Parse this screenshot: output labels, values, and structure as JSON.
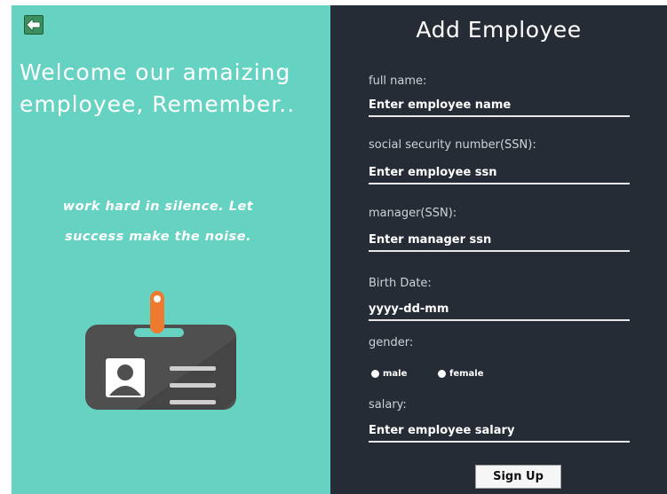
{
  "left_panel": {
    "welcome_line1": "Welcome our amaizing",
    "welcome_line2": "employee, Remember..",
    "quote_line1": "work hard in silence. Let",
    "quote_line2": "success make the noise.",
    "back_icon": "back-arrow-icon",
    "badge_icon": "employee-id-badge-icon",
    "colors": {
      "background": "#66d3c2",
      "badge": "#4f4f4f",
      "clip": "#ee7a2f"
    }
  },
  "form": {
    "title": "Add Employee",
    "full_name": {
      "label": "full name:",
      "placeholder": "Enter employee name"
    },
    "ssn": {
      "label": "social security number(SSN):",
      "placeholder": "Enter employee ssn"
    },
    "manager": {
      "label": "manager(SSN):",
      "placeholder": "Enter manager ssn"
    },
    "birth_date": {
      "label": "Birth Date:",
      "placeholder": "yyyy-dd-mm"
    },
    "gender": {
      "label": "gender:",
      "options": [
        "male",
        "female"
      ]
    },
    "salary": {
      "label": "salary:",
      "placeholder": "Enter employee salary"
    },
    "submit_label": "Sign Up",
    "colors": {
      "background": "#252c35"
    }
  }
}
